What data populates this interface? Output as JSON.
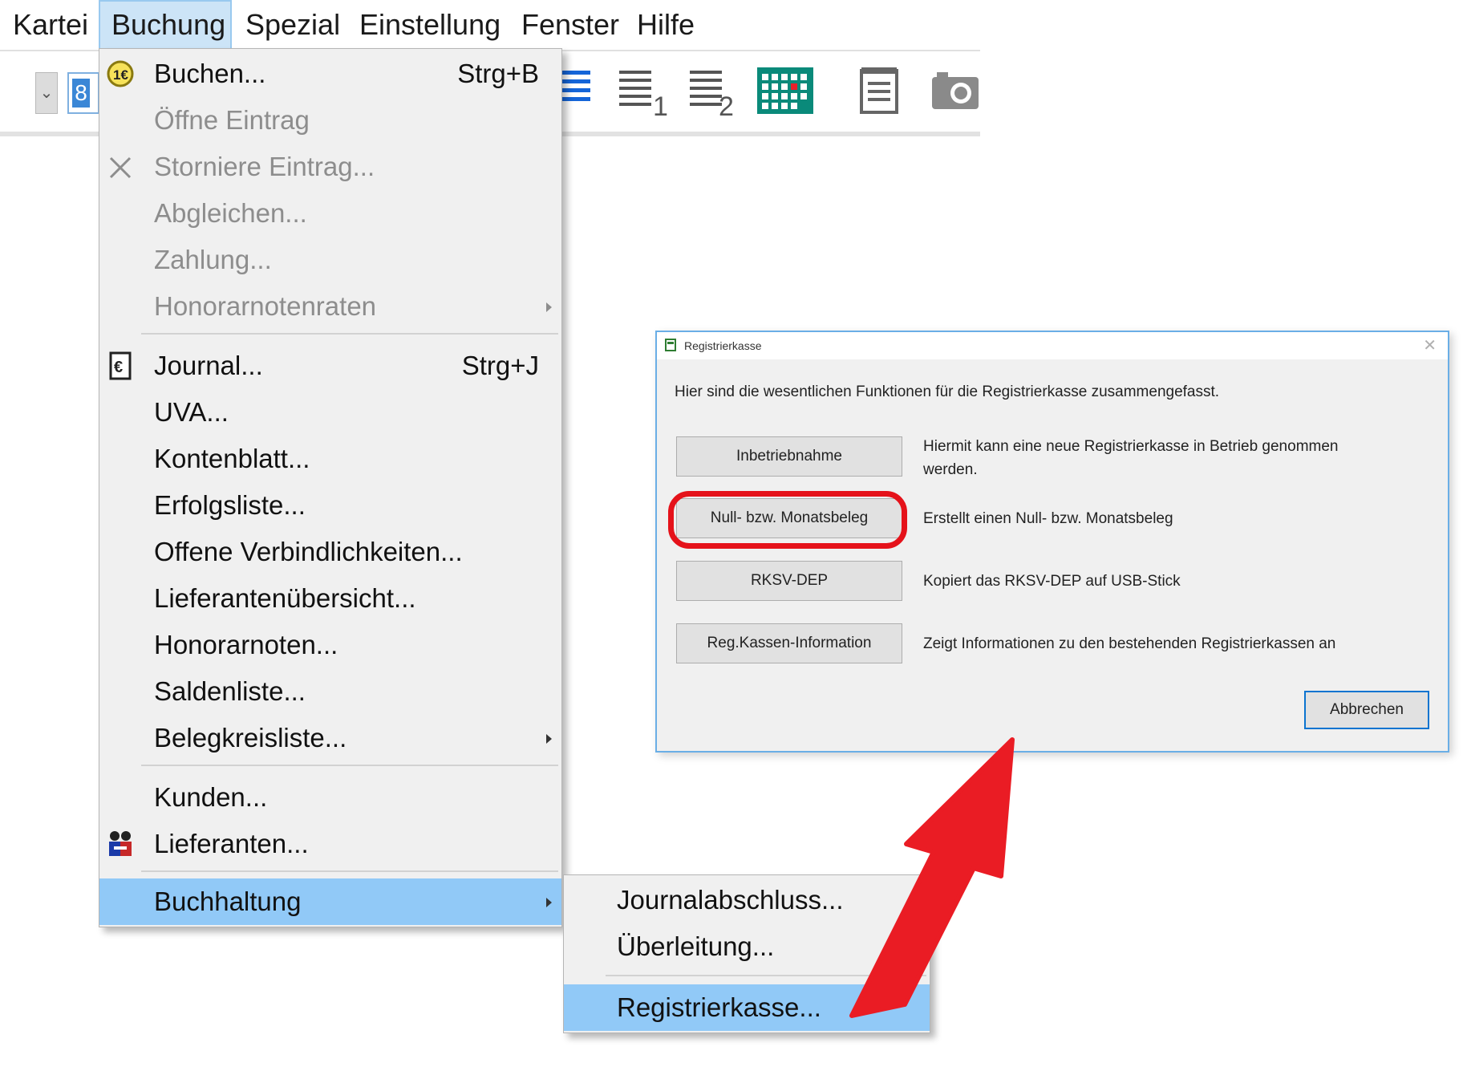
{
  "menubar": {
    "items": [
      "Kartei",
      "Buchung",
      "Spezial",
      "Einstellung",
      "Fenster",
      "Hilfe"
    ]
  },
  "toolbar": {
    "field_value": "8",
    "icons": [
      "align-justify-icon",
      "list-1-icon",
      "list-2-icon",
      "calendar-grid-icon",
      "notepad-icon",
      "camera-icon"
    ]
  },
  "menu": {
    "items": [
      {
        "label": "Buchen...",
        "shortcut": "Strg+B",
        "icon": "booking-icon",
        "enabled": true
      },
      {
        "label": "Öffne Eintrag",
        "enabled": false
      },
      {
        "label": "Storniere Eintrag...",
        "icon": "cancel-x-icon",
        "enabled": false
      },
      {
        "label": "Abgleichen...",
        "enabled": false
      },
      {
        "label": "Zahlung...",
        "enabled": false
      },
      {
        "label": "Honorarnotenraten",
        "submenu": true,
        "enabled": false
      },
      {
        "label": "Journal...",
        "shortcut": "Strg+J",
        "icon": "euro-icon",
        "enabled": true
      },
      {
        "label": "UVA...",
        "enabled": true
      },
      {
        "label": "Kontenblatt...",
        "enabled": true
      },
      {
        "label": "Erfolgsliste...",
        "enabled": true
      },
      {
        "label": "Offene Verbindlichkeiten...",
        "enabled": true
      },
      {
        "label": "Lieferantenübersicht...",
        "enabled": true
      },
      {
        "label": "Honorarnoten...",
        "enabled": true
      },
      {
        "label": "Saldenliste...",
        "enabled": true
      },
      {
        "label": "Belegkreisliste...",
        "submenu": true,
        "enabled": true
      },
      {
        "label": "Kunden...",
        "enabled": true
      },
      {
        "label": "Lieferanten...",
        "icon": "suppliers-icon",
        "enabled": true
      },
      {
        "label": "Buchhaltung",
        "submenu": true,
        "enabled": true,
        "highlighted": true
      }
    ]
  },
  "submenu": {
    "items": [
      {
        "label": "Journalabschluss..."
      },
      {
        "label": "Überleitung..."
      },
      {
        "label": "Registrierkasse...",
        "highlighted": true
      }
    ]
  },
  "dialog": {
    "title": "Registrierkasse",
    "close": "✕",
    "intro": "Hier sind die wesentlichen Funktionen für die Registrierkasse zusammengefasst.",
    "rows": [
      {
        "button": "Inbetriebnahme",
        "description": "Hiermit kann eine neue Registrierkasse in Betrieb genommen werden."
      },
      {
        "button": "Null- bzw. Monatsbeleg",
        "description": "Erstellt einen Null- bzw. Monatsbeleg"
      },
      {
        "button": "RKSV-DEP",
        "description": "Kopiert das RKSV-DEP auf USB-Stick"
      },
      {
        "button": "Reg.Kassen-Information",
        "description": "Zeigt Informationen zu den bestehenden Registrierkassen an"
      }
    ],
    "cancel": "Abbrechen"
  },
  "colors": {
    "menu_highlight": "#91c9f7",
    "menubar_active": "#cce4f7",
    "annotation_red": "#e5121a",
    "dialog_border": "#6aaee6"
  }
}
